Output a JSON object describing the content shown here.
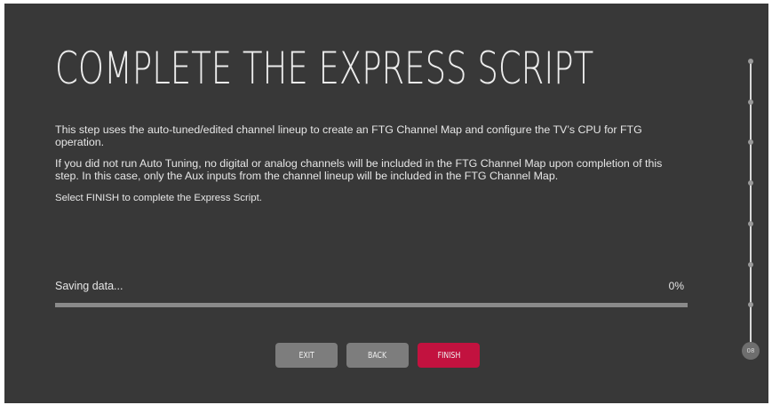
{
  "page": {
    "title": "COMPLETE THE EXPRESS SCRIPT",
    "paragraphs": [
      "This step uses the auto-tuned/edited channel lineup to create an FTG Channel Map and configure the TV’s CPU for FTG operation.",
      "If you did not run Auto Tuning, no digital or analog channels will be included in the FTG Channel Map upon completion of this step. In this case, only the Aux inputs from the channel lineup will be included in the FTG Channel Map.",
      "Select FINISH to complete the Express Script."
    ]
  },
  "progress": {
    "label": "Saving data...",
    "percent_text": "0%",
    "value": 0
  },
  "buttons": {
    "exit": "EXIT",
    "back": "BACK",
    "finish": "FINISH"
  },
  "stepper": {
    "total_steps": 8,
    "current_label": "08"
  },
  "colors": {
    "background": "#383838",
    "accent": "#c2123f",
    "button": "#7d7d7d",
    "text": "#e6e6e6"
  }
}
